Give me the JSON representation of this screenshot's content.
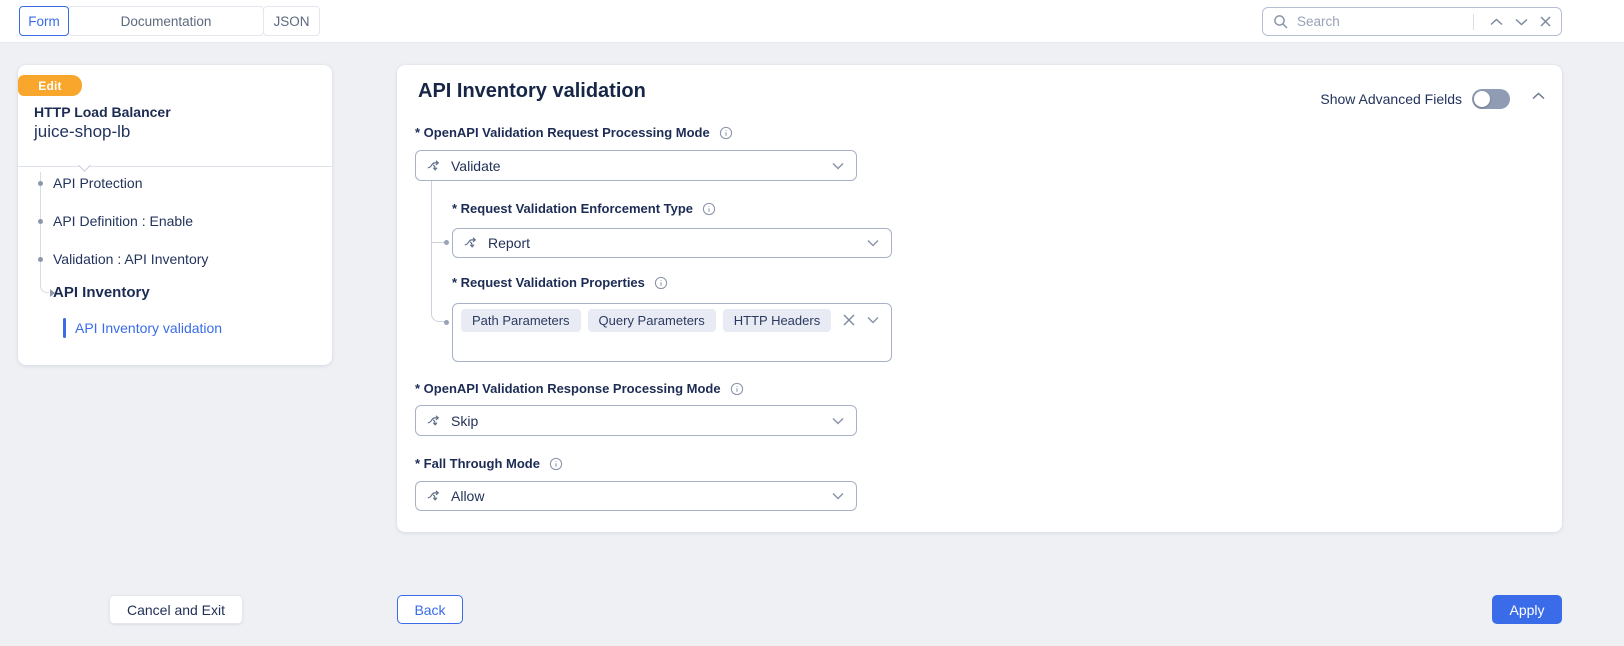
{
  "topbar": {
    "tabs": [
      {
        "label": "Form",
        "active": true
      },
      {
        "label": "Documentation",
        "active": false
      },
      {
        "label": "JSON",
        "active": false
      }
    ],
    "search": {
      "placeholder": "Search"
    }
  },
  "sidebar": {
    "badge": "Edit",
    "type_label": "HTTP Load Balancer",
    "object_name": "juice-shop-lb",
    "nav": [
      {
        "label": "API Protection"
      },
      {
        "label": "API Definition : Enable"
      },
      {
        "label": "Validation : API Inventory"
      },
      {
        "label": "API Inventory",
        "bold": true
      },
      {
        "label": "API Inventory validation",
        "active": true
      }
    ]
  },
  "panel": {
    "title": "API Inventory validation",
    "advanced_toggle_label": "Show Advanced Fields",
    "advanced_toggle_on": false,
    "fields": {
      "request_mode": {
        "label": "* OpenAPI Validation Request Processing Mode",
        "value": "Validate"
      },
      "enforcement_type": {
        "label": "* Request Validation Enforcement Type",
        "value": "Report"
      },
      "properties": {
        "label": "* Request Validation Properties",
        "chips": [
          "Path Parameters",
          "Query Parameters",
          "HTTP Headers"
        ]
      },
      "response_mode": {
        "label": "* OpenAPI Validation Response Processing Mode",
        "value": "Skip"
      },
      "fall_through": {
        "label": "* Fall Through Mode",
        "value": "Allow"
      }
    }
  },
  "footer": {
    "cancel_label": "Cancel and Exit",
    "back_label": "Back",
    "apply_label": "Apply"
  },
  "colors": {
    "accent_blue": "#3A6CE9",
    "badge_orange": "#F8A72C",
    "page_bg": "#EEF0F4",
    "panel_bg": "#FFFFFF",
    "text_navy": "#1E2C55",
    "input_border": "#A8B2C7",
    "icon_slate": "#7F8BA1",
    "chip_bg": "#E8EBF3",
    "toggle_off_track": "#8F9CB4"
  }
}
